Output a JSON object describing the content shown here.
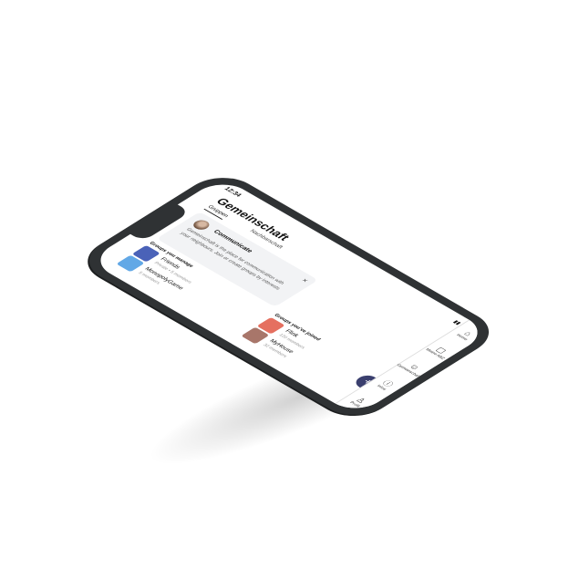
{
  "status": {
    "time": "12:34",
    "icons": "▮▮ ᯤ ▭"
  },
  "header": {
    "title": "Gemeinschaft"
  },
  "tabs": [
    {
      "label": "Gruppen"
    },
    {
      "label": "Nachbarschaft"
    }
  ],
  "info_card": {
    "title": "Communicate",
    "text": "Gemeinschaft is the place for communication with your neighbours. Join or create groups by interests",
    "close_glyph": "×"
  },
  "manage": {
    "heading": "Groups you manage",
    "items": [
      {
        "name": "Friends",
        "meta": "Private  •  5 members",
        "color": "#4a62b8"
      },
      {
        "name": "MonopolyGame",
        "meta": "5 members",
        "color": "#62a8e6"
      }
    ]
  },
  "joined": {
    "heading": "Groups you've joined",
    "items": [
      {
        "name": "Flink",
        "meta": "120 members",
        "color": "#e57060"
      },
      {
        "name": "MyHouse",
        "meta": "32 members",
        "color": "#a8766a"
      }
    ]
  },
  "fab": {
    "glyph": "+"
  },
  "nav": [
    {
      "label": "Home",
      "icon": "⌂"
    },
    {
      "label": "Meine ABZ",
      "icon": "▢"
    },
    {
      "label": "Gemeinschaft",
      "icon": "☺"
    },
    {
      "label": "Infos",
      "icon": "ⓘ"
    },
    {
      "label": "Profil",
      "icon": "♙"
    }
  ]
}
